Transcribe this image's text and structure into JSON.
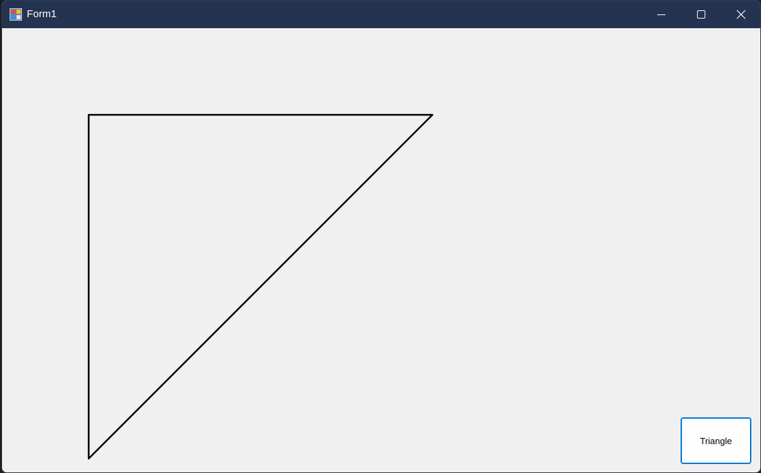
{
  "window": {
    "title": "Form1",
    "icon": "winforms-app-icon"
  },
  "titlebar": {
    "minimize_icon": "minimize-icon",
    "maximize_icon": "maximize-icon",
    "close_icon": "close-icon"
  },
  "canvas": {
    "shape": "triangle",
    "stroke_color": "#000000"
  },
  "buttons": {
    "triangle_label": "Triangle"
  },
  "colors": {
    "titlebar": "#243350",
    "client_bg": "#f0f0f0",
    "button_border": "#0078d4"
  }
}
